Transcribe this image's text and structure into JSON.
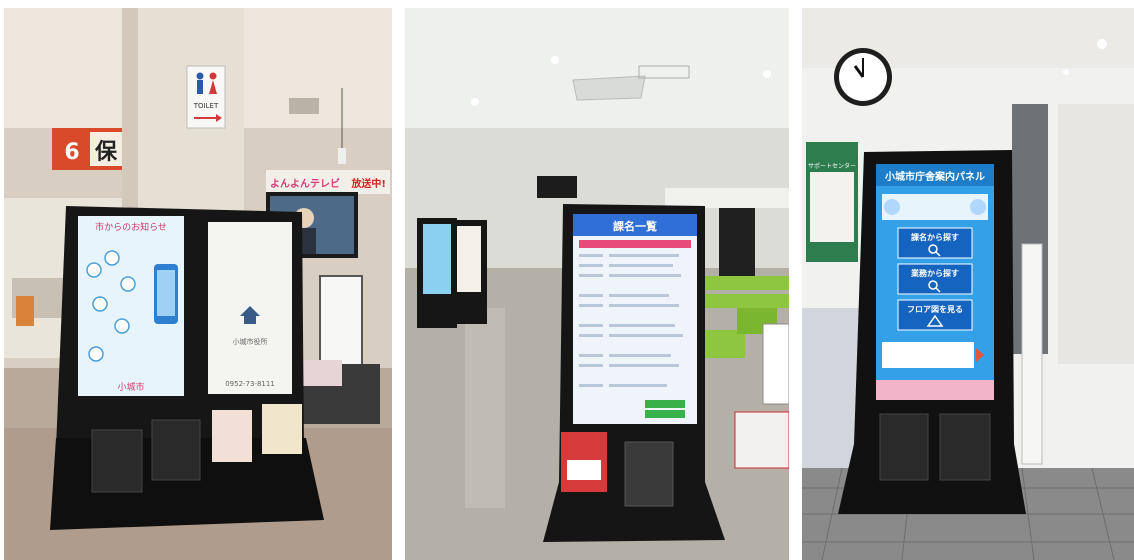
{
  "photos": [
    {
      "toilet_sign": "TOILET",
      "counter_number": "6",
      "counter_char": "保",
      "tv_banner_left": "よんよんテレビ",
      "tv_banner_right": "放送中!",
      "screen_left_header": "市からのお知らせ",
      "screen_left_footer": "小城市",
      "screen_right_text": "小城市役所",
      "screen_right_phone": "0952-73-8111",
      "colors": {
        "cabinet": "#161616",
        "screen_left_bg": "#e8f4fb",
        "counter_sign": "#d94a2a"
      }
    },
    {
      "screen_title": "課名一覧",
      "colors": {
        "cabinet": "#151515",
        "screen_header": "#2f6fd6",
        "chairs": "#8dc63f"
      }
    },
    {
      "kiosk_title": "小城市庁舎案内パネル",
      "btn_search_dept": "課名から探す",
      "btn_search_work": "業務から探す",
      "btn_floor_map": "フロア図を見る",
      "poster_title": "サポートセンター",
      "colors": {
        "kiosk_bg": "#34a0e8",
        "kiosk_button": "#1565c0",
        "floor_tile": "#8a8a8a"
      }
    }
  ]
}
